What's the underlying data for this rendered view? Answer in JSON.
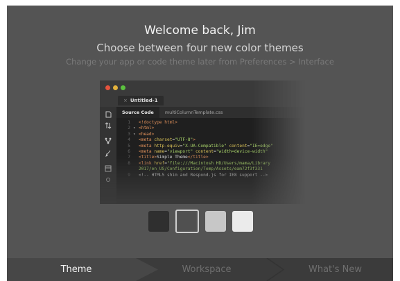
{
  "welcome": {
    "greeting": "Welcome back, Jim",
    "subtitle": "Choose between four new color themes",
    "hint": "Change your app or code theme later from Preferences > Interface"
  },
  "editor_preview": {
    "document_tab": "Untitled-1",
    "file_tabs": [
      "Source Code",
      "multiColumnTemplate.css"
    ],
    "code_lines": [
      {
        "n": "1",
        "arrow": "",
        "parts": [
          [
            "tag",
            "<!doctype html>"
          ]
        ]
      },
      {
        "n": "2",
        "arrow": "▾",
        "parts": [
          [
            "tag",
            "<html>"
          ]
        ]
      },
      {
        "n": "3",
        "arrow": "▾",
        "parts": [
          [
            "tag",
            "<head>"
          ]
        ]
      },
      {
        "n": "4",
        "arrow": "",
        "parts": [
          [
            "tag",
            "<meta "
          ],
          [
            "attr",
            "charset"
          ],
          [
            "txt",
            "="
          ],
          [
            "str",
            "\"UTF-8\""
          ],
          [
            "tag",
            ">"
          ]
        ]
      },
      {
        "n": "5",
        "arrow": "",
        "parts": [
          [
            "tag",
            "<meta "
          ],
          [
            "attr",
            "http-equiv"
          ],
          [
            "txt",
            "="
          ],
          [
            "str",
            "\"X-UA-Compatible\""
          ],
          [
            "txt",
            " "
          ],
          [
            "attr",
            "content"
          ],
          [
            "txt",
            "="
          ],
          [
            "str",
            "\"IE=edge\""
          ]
        ]
      },
      {
        "n": "6",
        "arrow": "",
        "parts": [
          [
            "tag",
            "<meta "
          ],
          [
            "attr",
            "name"
          ],
          [
            "txt",
            "="
          ],
          [
            "str",
            "\"viewport\""
          ],
          [
            "txt",
            " "
          ],
          [
            "attr",
            "content"
          ],
          [
            "txt",
            "="
          ],
          [
            "str",
            "\"width=device-width\""
          ]
        ]
      },
      {
        "n": "7",
        "arrow": "",
        "parts": [
          [
            "tag",
            "<title>"
          ],
          [
            "txt",
            "Simple Theme"
          ],
          [
            "tag",
            "</title>"
          ]
        ]
      },
      {
        "n": "8",
        "arrow": "",
        "parts": [
          [
            "tag",
            "<link "
          ],
          [
            "attr",
            "href"
          ],
          [
            "txt",
            "="
          ],
          [
            "str",
            "\"file:///Macintosh HD/Users/mama/Library"
          ]
        ]
      },
      {
        "n": "",
        "arrow": "",
        "parts": [
          [
            "str",
            "2017/en_US/Configuration/Temp/Assets/eam72f3f331"
          ]
        ]
      },
      {
        "n": "9",
        "arrow": "",
        "parts": [
          [
            "txt",
            "<!-- HTML5 shim and Respond.js for IE8 support -->"
          ]
        ]
      }
    ]
  },
  "themes": {
    "options": [
      {
        "name": "darkest",
        "color": "#2f2f2f"
      },
      {
        "name": "dark",
        "color": "#505050"
      },
      {
        "name": "light",
        "color": "#c7c7c7"
      },
      {
        "name": "lightest",
        "color": "#ebebeb"
      }
    ],
    "selected_index": 1
  },
  "stepper": {
    "steps": [
      "Theme",
      "Workspace",
      "What's New"
    ],
    "active_index": 0
  },
  "colors": {
    "dialog_bg": "#545454",
    "accent_border": "#cfcfcf"
  }
}
